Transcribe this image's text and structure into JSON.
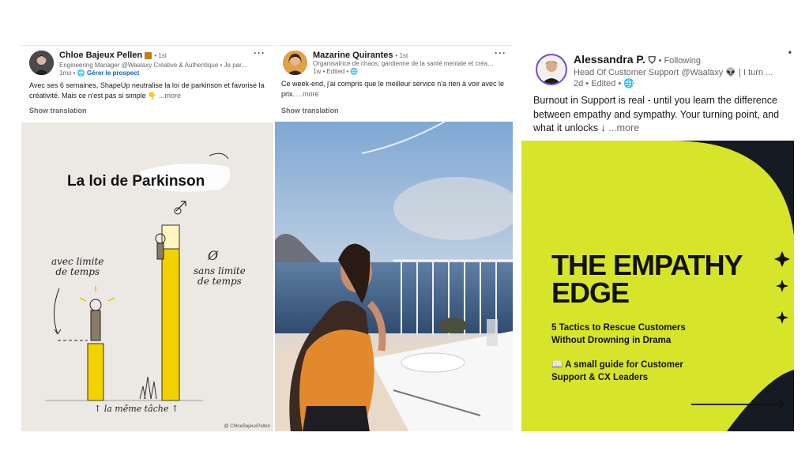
{
  "posts": [
    {
      "author": "Chloe Bajeux Pellen",
      "badge_icon": "linkedin-premium-icon",
      "degree": "• 1st",
      "headline": "Engineering Manager @Waalaxy Créative & Authentique • Je par...",
      "time": "1mo •",
      "action": "Gérer le prospect",
      "menu": "···",
      "text": "Avec ses 6 semaines, ShapeUp neutralise la loi de parkinson et favorise la créativité. Mais ce n'est pas si simple 👇",
      "more": "...more",
      "translation": "Show translation",
      "image": {
        "title": "La loi de Parkinson",
        "left_label_line1": "avec limite",
        "left_label_line2": "de temps",
        "right_symbol": "Ø",
        "right_label_line1": "sans limite",
        "right_label_line2": "de temps",
        "bottom_label": "↑ la même tâche ↑",
        "credit": "@ ChloeBajeuxPellen"
      }
    },
    {
      "author": "Mazarine Quirantes",
      "degree": "• 1st",
      "headline": "Organisatrice de chaos, gardienne de la santé mentale et créatri...",
      "time": "1w • Edited •",
      "menu": "···",
      "text": "Ce week-end, j'ai compris que le meilleur service n'a rien à voir avec le prix.",
      "more": "...more",
      "translation": "Show translation"
    },
    {
      "author": "Alessandra P.",
      "follow": "• Following",
      "headline": "Head Of Customer Support @Waalaxy 👽 | I turn ...",
      "time": "2d • Edited •",
      "menu": "•",
      "text": "Burnout in Support is real - until you learn the difference between empathy and sympathy. Your turning point, and what it unlocks ↓",
      "more": "...more",
      "image": {
        "title_line1": "THE EMPATHY",
        "title_line2": "EDGE",
        "subtitle_line1": "5 Tactics to Rescue Customers",
        "subtitle_line2": "Without Drowning in Drama",
        "guide_line1": "📖 A small guide for Customer",
        "guide_line2": "Support & CX Leaders"
      }
    }
  ],
  "colors": {
    "linkedin_blue": "#0a66c2",
    "empathy_yellow": "#d7e52a",
    "empathy_dark": "#161a22",
    "parkinson_bg": "#ece9e4",
    "parkinson_yellow": "#f1d200"
  }
}
